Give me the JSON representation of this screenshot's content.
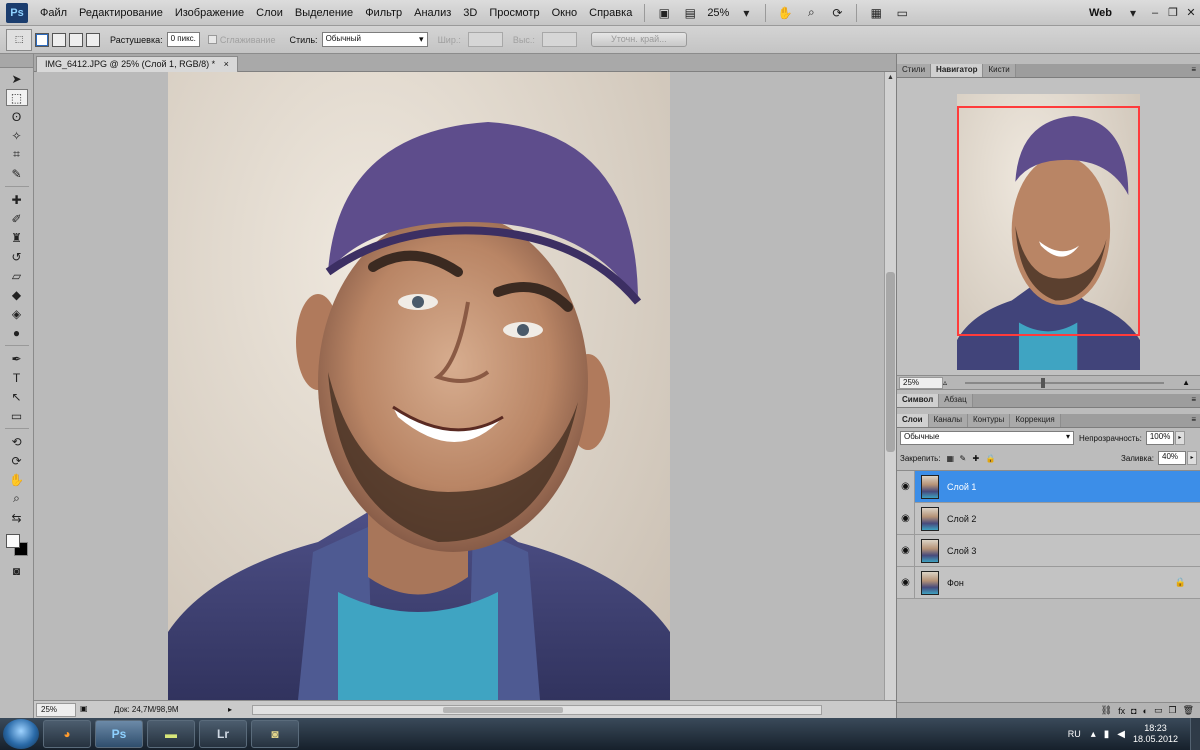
{
  "app": {
    "logo_text": "Ps"
  },
  "menubar": {
    "items": [
      "Файл",
      "Редактирование",
      "Изображение",
      "Слои",
      "Выделение",
      "Фильтр",
      "Анализ",
      "3D",
      "Просмотр",
      "Окно",
      "Справка"
    ],
    "zoom": "25%",
    "workspace": "Web"
  },
  "options": {
    "feather_label": "Растушевка:",
    "feather_value": "0 пикс.",
    "antialias_label": "Сглаживание",
    "style_label": "Стиль:",
    "style_value": "Обычный",
    "width_label": "Шир.:",
    "height_label": "Выс.:",
    "refine_button": "Уточн. край..."
  },
  "document": {
    "tab_title": "IMG_6412.JPG @ 25% (Слой 1, RGB/8) *",
    "close_glyph": "×",
    "status_zoom": "25%",
    "status_doc": "Док: 24,7M/98,9M"
  },
  "panels": {
    "top_tabs": [
      "Стили",
      "Навигатор",
      "Кисти"
    ],
    "navigator_zoom": "25%",
    "mid_tabs": [
      "Символ",
      "Абзац"
    ],
    "layer_tabs": [
      "Слои",
      "Каналы",
      "Контуры",
      "Коррекция"
    ],
    "blend_mode": "Обычные",
    "opacity_label": "Непрозрачность:",
    "opacity_value": "100%",
    "lock_label": "Закрепить:",
    "fill_label": "Заливка:",
    "fill_value": "40%",
    "layers": [
      {
        "name": "Слой 1",
        "selected": true,
        "locked": false
      },
      {
        "name": "Слой 2",
        "selected": false,
        "locked": false
      },
      {
        "name": "Слой 3",
        "selected": false,
        "locked": false
      },
      {
        "name": "Фон",
        "selected": false,
        "locked": true
      }
    ]
  },
  "taskbar": {
    "apps": [
      "Ps",
      "Lr"
    ],
    "language": "RU",
    "time": "18:23",
    "date": "18.05.2012"
  }
}
